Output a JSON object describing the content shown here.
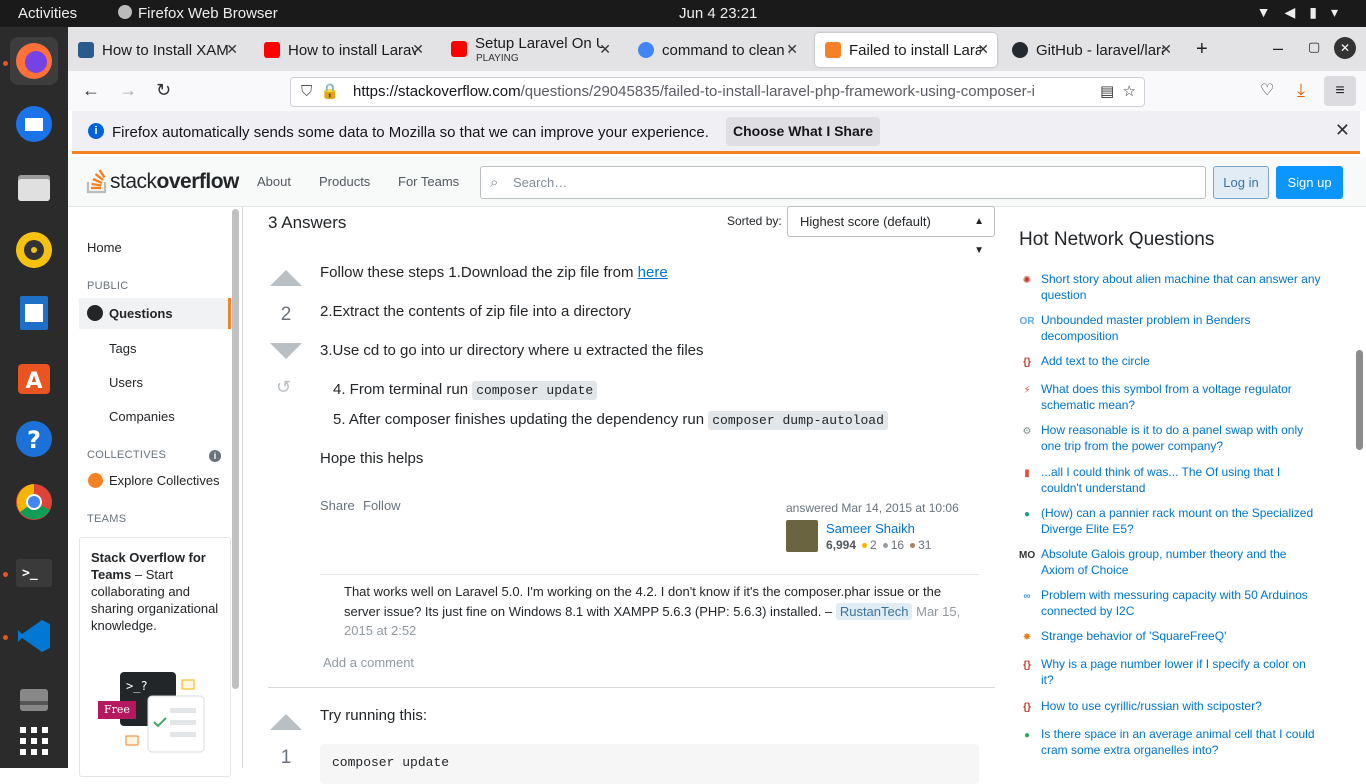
{
  "topbar": {
    "activities": "Activities",
    "app_name": "Firefox Web Browser",
    "clock": "Jun 4  23:21"
  },
  "dock": [
    "firefox-icon",
    "thunderbird-icon",
    "files-icon",
    "rhythmbox-icon",
    "writer-icon",
    "software-icon",
    "help-icon",
    "chrome-icon",
    "terminal-icon",
    "vscode-icon",
    "disk-icon",
    "apps-grid-icon"
  ],
  "tabs": [
    {
      "label": "How to Install XAMPP",
      "color": "#2a5b8c"
    },
    {
      "label": "How to install Laravel",
      "color": "#ff0000"
    },
    {
      "label": "Setup Laravel On Ubuntu",
      "sub": "PLAYING",
      "color": "#ff0000"
    },
    {
      "label": "command to clean in",
      "color": "#4285f4"
    },
    {
      "label": "Failed to install Laravel",
      "color": "#f48225"
    },
    {
      "label": "GitHub - laravel/lara",
      "color": "#24292f"
    }
  ],
  "url": {
    "host": "https://stackoverflow.com",
    "path": "/questions/29045835/failed-to-install-laravel-php-framework-using-composer-i"
  },
  "notification": {
    "message": "Firefox automatically sends some data to Mozilla so that we can improve your experience.",
    "button": "Choose What I Share"
  },
  "header": {
    "logo_a": "stack",
    "logo_b": "overflow",
    "nav": [
      "About",
      "Products",
      "For Teams"
    ],
    "search_placeholder": "Search…",
    "login": "Log in",
    "signup": "Sign up"
  },
  "sidebar": {
    "home": "Home",
    "public": "PUBLIC",
    "questions": "Questions",
    "tags": "Tags",
    "users": "Users",
    "companies": "Companies",
    "collectives": "COLLECTIVES",
    "explore": "Explore Collectives",
    "teams": "TEAMS",
    "teams_title": "Stack Overflow for Teams",
    "teams_text": " – Start collaborating and sharing organizational knowledge.",
    "free": "Free"
  },
  "answers": {
    "title": "3 Answers",
    "sorted_by": "Sorted by:",
    "sort_value": "Highest score (default)"
  },
  "answer1": {
    "score": "2",
    "p1_pre": "Follow these steps 1.Download the zip file from ",
    "p1_link": "here",
    "p2": "2.Extract the contents of zip file into a directory",
    "p3": "3.Use cd to go into ur directory where u extracted the files",
    "li4_pre": "4. From terminal run ",
    "li4_code": "composer update",
    "li5_pre": "5. After composer finishes updating the dependency run ",
    "li5_code": "composer dump-autoload",
    "p4": "Hope this helps",
    "share": "Share",
    "follow": "Follow",
    "answered": "answered Mar 14, 2015 at 10:06",
    "user": "Sameer Shaikh",
    "rep": "6,994",
    "gold": "2",
    "silver": "16",
    "bronze": "31",
    "comment_text": "That works well on Laravel 5.0. I'm working on the 4.2. I don't know if it's the composer.phar issue or the server issue? Its just fine on Windows 8.1 with XAMPP 5.6.3 (PHP: 5.6.3) installed. – ",
    "comment_user": "RustanTech",
    "comment_date": "Mar 15, 2015 at 2:52",
    "add_comment": "Add a comment"
  },
  "answer2": {
    "score": "1",
    "p1": "Try running this:",
    "code": "composer update"
  },
  "hnq": {
    "title": "Hot Network Questions",
    "items": [
      {
        "text": "Short story about alien machine that can answer any question",
        "icon": "scifi-icon",
        "color": "#c0392b"
      },
      {
        "text": "Unbounded master problem in Benders decomposition",
        "icon": "or-icon",
        "color": "#5dade2"
      },
      {
        "text": "Add text to the circle",
        "icon": "tex-icon",
        "color": "#c0392b"
      },
      {
        "text": "What does this symbol from a voltage regulator schematic mean?",
        "icon": "electronics-icon",
        "color": "#e74c3c"
      },
      {
        "text": "How reasonable is it to do a panel swap with only one trip from the power company?",
        "icon": "diy-icon",
        "color": "#7f8c8d"
      },
      {
        "text": "...all I could think of was... The Of using that I couldn't understand",
        "icon": "ell-icon",
        "color": "#e74c3c"
      },
      {
        "text": "(How) can a pannier rack mount on the Specialized Diverge Elite E5?",
        "icon": "bicycles-icon",
        "color": "#16a085"
      },
      {
        "text": "Absolute Galois group, number theory and the Axiom of Choice",
        "icon": "mo-icon",
        "color": "#333333"
      },
      {
        "text": "Problem with messuring capacity with 50 Arduinos connected by I2C",
        "icon": "arduino-icon",
        "color": "#3498db"
      },
      {
        "text": "Strange behavior of 'SquareFreeQ'",
        "icon": "mathematica-icon",
        "color": "#e67e22"
      },
      {
        "text": "Why is a page number lower if I specify a color on it?",
        "icon": "tex-icon",
        "color": "#c0392b"
      },
      {
        "text": "How to use cyrillic/russian with sciposter?",
        "icon": "tex-icon",
        "color": "#c0392b"
      },
      {
        "text": "Is there space in an average animal cell that I could cram some extra organelles into?",
        "icon": "biology-icon",
        "color": "#27ae60"
      }
    ]
  }
}
